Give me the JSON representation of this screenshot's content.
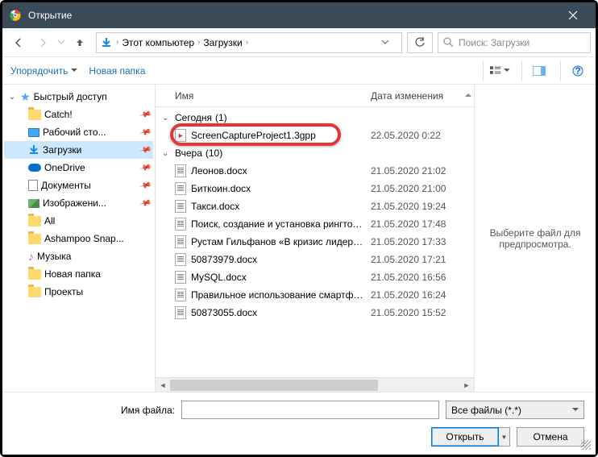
{
  "title": "Открытие",
  "breadcrumb": {
    "root": "Этот компьютер",
    "folder": "Загрузки"
  },
  "search": {
    "placeholder": "Поиск: Загрузки"
  },
  "toolbar": {
    "organize": "Упорядочить",
    "newfolder": "Новая папка"
  },
  "columns": {
    "name": "Имя",
    "date": "Дата изменения"
  },
  "sidebar": {
    "quickaccess": "Быстрый доступ",
    "items": [
      {
        "label": "Catch!"
      },
      {
        "label": "Рабочий сто..."
      },
      {
        "label": "Загрузки"
      },
      {
        "label": "OneDrive"
      },
      {
        "label": "Документы"
      },
      {
        "label": "Изображени..."
      },
      {
        "label": "All"
      },
      {
        "label": "Ashampoo Snap..."
      },
      {
        "label": "Музыка"
      },
      {
        "label": "Новая папка"
      },
      {
        "label": "Проекты"
      }
    ]
  },
  "groups": [
    {
      "name": "Сегодня",
      "count": "(1)",
      "files": [
        {
          "name": "ScreenCaptureProject1.3gpp",
          "date": "22.05.2020 0:22",
          "type": "vid"
        }
      ]
    },
    {
      "name": "Вчера",
      "count": "(10)",
      "files": [
        {
          "name": "Леонов.docx",
          "date": "21.05.2020 21:02",
          "type": "docx"
        },
        {
          "name": "Биткоин.docx",
          "date": "21.05.2020 21:00",
          "type": "docx"
        },
        {
          "name": "Такси.docx",
          "date": "21.05.2020 19:24",
          "type": "docx"
        },
        {
          "name": "Поиск, создание и установка рингтоно...",
          "date": "21.05.2020 17:48",
          "type": "docx"
        },
        {
          "name": "Рустам Гильфанов «В кризис лидеры д...",
          "date": "21.05.2020 17:33",
          "type": "docx"
        },
        {
          "name": "50873979.docx",
          "date": "21.05.2020 17:21",
          "type": "docx"
        },
        {
          "name": "MySQL.docx",
          "date": "21.05.2020 16:56",
          "type": "docx"
        },
        {
          "name": "Правильное использование смартфон...",
          "date": "21.05.2020 16:24",
          "type": "docx"
        },
        {
          "name": "50873055.docx",
          "date": "21.05.2020 15:52",
          "type": "docx"
        }
      ]
    }
  ],
  "preview": {
    "text": "Выберите файл для предпросмотра."
  },
  "bottom": {
    "filename_label": "Имя файла:",
    "filetype": "Все файлы (*.*)",
    "open": "Открыть",
    "cancel": "Отмена"
  }
}
